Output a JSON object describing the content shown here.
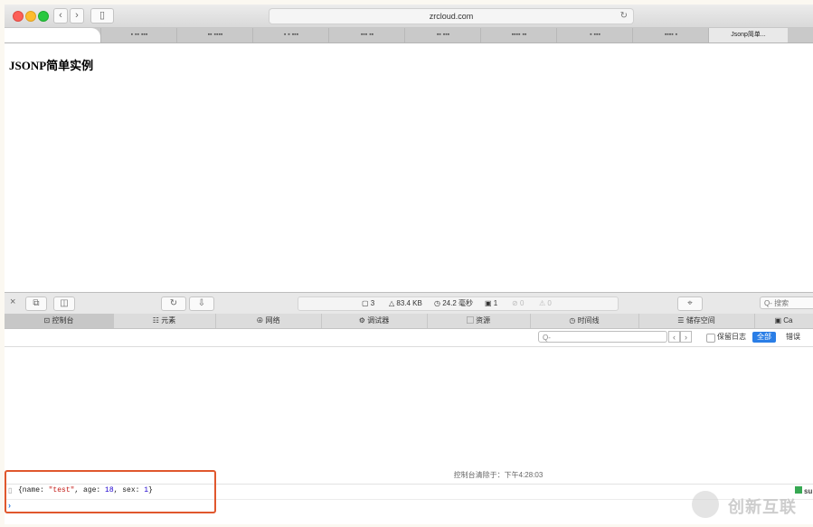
{
  "browser": {
    "address": "zrcloud.com",
    "tabs": [
      {
        "label": ""
      },
      {
        "label": "▪ ▪▪ ▪▪▪"
      },
      {
        "label": "▪▪ ▪▪▪▪"
      },
      {
        "label": "▪ ▪ ▪▪▪"
      },
      {
        "label": "▪▪▪ ▪▪"
      },
      {
        "label": "▪▪ ▪▪▪"
      },
      {
        "label": "▪▪▪▪ ▪▪"
      },
      {
        "label": "▪ ▪▪▪"
      },
      {
        "label": "▪▪▪▪ ▪"
      },
      {
        "label": "Jsonp简单..."
      }
    ]
  },
  "page": {
    "heading": "JSONP简单实例"
  },
  "devtools": {
    "stats": {
      "resources": "3",
      "size": "83.4 KB",
      "time": "24.2 毫秒",
      "logs": "1",
      "errors": "0",
      "warnings": "0"
    },
    "search_placeholder": "搜索",
    "tabs": [
      "控制台",
      "元素",
      "网络",
      "调试器",
      "资源",
      "时间线",
      "储存空间",
      "Ca"
    ],
    "filter": {
      "placeholder": "Q-",
      "preserve_log": "保留日志",
      "all": "全部",
      "errors": "错误"
    },
    "console": {
      "cleared": "控制台清除于：下午4:28:03",
      "log_entry": {
        "open": "{name: ",
        "name_val": "\"test\"",
        "mid1": ", age: ",
        "age_val": "18",
        "mid2": ", sex: ",
        "sex_val": "1",
        "close": "}"
      },
      "prompt": "›"
    }
  },
  "watermark": {
    "text": "创新互联"
  },
  "side_badge": {
    "text": "su"
  },
  "colors": {
    "highlight": "#e0572d",
    "accent": "#2a7ee6",
    "string": "#c41a16",
    "number": "#1c00cf"
  }
}
